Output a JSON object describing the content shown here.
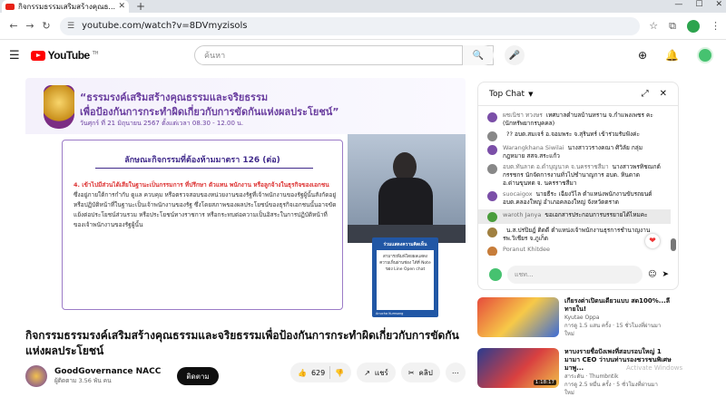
{
  "browser": {
    "tab_title": "กิจกรรมธรรมเสริมสร้างคุณธ...",
    "url": "youtube.com/watch?v=8DVmyzisols",
    "win_min": "—",
    "win_max": "☐",
    "win_close": "✕"
  },
  "masthead": {
    "logo_text": "YouTube",
    "logo_th": "TH",
    "search_placeholder": "ค้นหา"
  },
  "slide": {
    "title_line1": "“ธรรมรงค์เสริมสร้างคุณธรรมและจริยธรรม",
    "title_line2": "เพื่อป้องกันการกระทำผิดเกี่ยวกับการขัดกันแห่งผลประโยชน์”",
    "date": "วันศุกร์ ที่ 21 มิถุนายน 2567 ตั้งแต่เวลา 08.30 - 12.00 น.",
    "box_title": "ลักษณะกิจกรรมที่ต้องห้ามมาตรา 126 (ต่อ)",
    "box_body_red": "4. เข้าไปมีส่วนได้เสียในฐานะเป็นกรรมการ ที่ปรึกษา ตัวแทน พนักงาน หรือลูกจ้างในธุรกิจของเอกชน",
    "box_body": " ซึ่งอยู่ภายใต้การกำกับ ดูแล ควบคุม หรือตรวจสอบของหน่วยงานของรัฐที่เจ้าพนักงานของรัฐผู้นั้นสังกัดอยู่หรือปฏิบัติหน้าที่ในฐานะเป็นเจ้าพนักงานของรัฐ ซึ่งโดยสภาพของผลประโยชน์ของธุรกิจเอกชนนั้นอาจขัดแย้งต่อประโยชน์ส่วนรวม หรือประโยชน์ทางราชการ หรือกระทบต่อความเป็นอิสระในการปฏิบัติหน้าที่ของเจ้าพนักงานของรัฐผู้นั้น",
    "chat_card_head": "ร่วมแสดงความคิดเห็น",
    "chat_card_body": "สามารถพิมพ์โดยผลแสดงความเห็นผ่านช่อง ได้ที่ Note ของ Line Open chat",
    "chat_card_foot": "Anucha Kumsong"
  },
  "video": {
    "title": "กิจกรรมธรรมรงค์เสริมสร้างคุณธรรมและจริยธรรมเพื่อป้องกันการกระทำผิดเกี่ยวกับการขัดกันแห่งผลประโยชน์",
    "channel": "GoodGovernance NACC",
    "subs": "ผู้ติดตาม 3.56 พัน คน",
    "subscribe": "ติดตาม",
    "likes": "629",
    "share": "แชร์",
    "clip": "คลิป"
  },
  "chat": {
    "header": "Top Chat",
    "placeholder": "แชท...",
    "messages": [
      {
        "name": "ผชเนิชา ทวงษร",
        "text": "เทศบาลตำบลบ้านหราน จ.กำแพงเพชร คะ (นักทรัพยากรบุคคล)",
        "color": "#7b4fa8"
      },
      {
        "name": "",
        "text": "?? อบต.สมเจร์ อ.จอมพระ จ.สุรินทร์ เข้าร่วมรับฟังค่ะ",
        "color": "#888888"
      },
      {
        "name": "Warangkhana Siwilai",
        "text": "นางสาววรางคณา ศิวิลัย กลุ่มกฎหมาย สสจ.สระแก้ว",
        "color": "#7b4fa8"
      },
      {
        "name": "อบต.ทันลาด อ.ดำบุญนาค จ.นครราชสีมา",
        "text": "นางสาวพรทิชณกต์ กรรชกร นักจัดการงานทั่วไปชำนาญการ อบต. หินดาด อ.ด่านขุนทด จ. นครราชสีมา",
        "color": "#888888"
      },
      {
        "name": "suocaigox",
        "text": "นายธีระ เฉียงวิไล ตำแหน่งพนักงานขับรถยนต์ อบต.คลองใหญ่ อำเภอคลองใหญ่ จังหวัดตราด",
        "color": "#7b4fa8"
      },
      {
        "name": "waroth Janya",
        "text": "ขอเอกสารประกอบการบรรยายได้ไหมคะ",
        "color": "#4a9d3c"
      },
      {
        "name": "",
        "text": "น.ส.ปรปิยฎ์ ติดดี ตำแหน่งเจ้าพนักงานธุรการชำนาญงาน รพ.วิเชียร จ.ภูเก็ต",
        "color": "#a08040"
      },
      {
        "name": "Poranut Khitdee",
        "text": "",
        "color": "#c77d3a"
      }
    ]
  },
  "recs": [
    {
      "title": "เกียรงต่าเปิดนเดียวแบบ สด100%...ลีทายใน!",
      "channel": "Kyutae Oppa",
      "views": "การดู 1.5 แสน ครั้ง · 15 ชั่วโมงที่ผ่านมา",
      "duration": "",
      "badge": "ใหม่"
    },
    {
      "title": "หาบงรายชื่อปังเพงที่สอบรอบใหญ่ 1 มามา CEO ว่าบนท่านรองชวรชนพิเศษมาพู...",
      "channel": "สาระดัน · Thumbntik",
      "views": "การดู 2.5 หมื่น ครั้ง · 5 ชั่วโมงที่ผ่านมา",
      "duration": "1:18:17",
      "badge": "ใหม่"
    }
  ],
  "watermark": "Activate Windows"
}
